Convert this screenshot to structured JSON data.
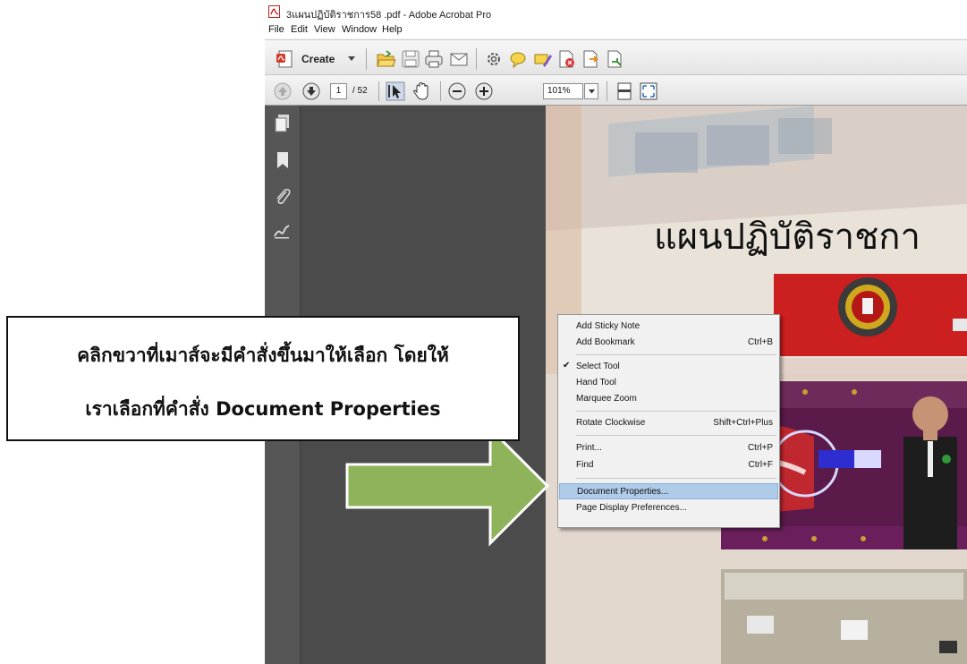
{
  "window": {
    "title": "3แผนปฏิบัติราชการ58 .pdf - Adobe Acrobat Pro"
  },
  "menubar": {
    "items": [
      "File",
      "Edit",
      "View",
      "Window",
      "Help"
    ]
  },
  "toolbar": {
    "create_label": "Create"
  },
  "navbar": {
    "current_page": "1",
    "page_total": "/ 52",
    "zoom": "101%"
  },
  "document": {
    "heading": "แผนปฏิบัติราชกา"
  },
  "context_menu": {
    "items": [
      {
        "label": "Add Sticky Note",
        "shortcut": ""
      },
      {
        "label": "Add Bookmark",
        "shortcut": "Ctrl+B"
      },
      {
        "label": "Select Tool",
        "shortcut": "",
        "checked": true
      },
      {
        "label": "Hand Tool",
        "shortcut": ""
      },
      {
        "label": "Marquee Zoom",
        "shortcut": ""
      },
      {
        "label": "Rotate Clockwise",
        "shortcut": "Shift+Ctrl+Plus"
      },
      {
        "label": "Print...",
        "shortcut": "Ctrl+P"
      },
      {
        "label": "Find",
        "shortcut": "Ctrl+F"
      },
      {
        "label": "Document Properties...",
        "shortcut": "",
        "highlighted": true
      },
      {
        "label": "Page Display Preferences...",
        "shortcut": ""
      }
    ],
    "checkmark": "✔"
  },
  "callout": {
    "line1": "คลิกขวาที่เมาส์จะมีคำสั่งขึ้นมาให้เลือก โดยให้",
    "line2": "เราเลือกที่คำสั่ง Document Properties"
  },
  "colors": {
    "arrow_fill": "#8fb35a",
    "menu_highlight": "#aecbe9",
    "banner_red": "#cc1f1f"
  },
  "icons": [
    "create-icon",
    "open-folder-icon",
    "save-icon",
    "print-icon",
    "email-icon",
    "settings-gear-icon",
    "comment-icon",
    "highlight-icon",
    "pdf-sign-icon",
    "pdf-export-icon",
    "pdf-combine-icon",
    "page-up-icon",
    "page-down-icon",
    "select-tool-icon",
    "hand-tool-icon",
    "zoom-out-icon",
    "zoom-in-icon",
    "fit-width-icon",
    "full-screen-icon",
    "page-thumbnails-icon",
    "bookmarks-icon",
    "attachments-icon",
    "signatures-icon"
  ]
}
